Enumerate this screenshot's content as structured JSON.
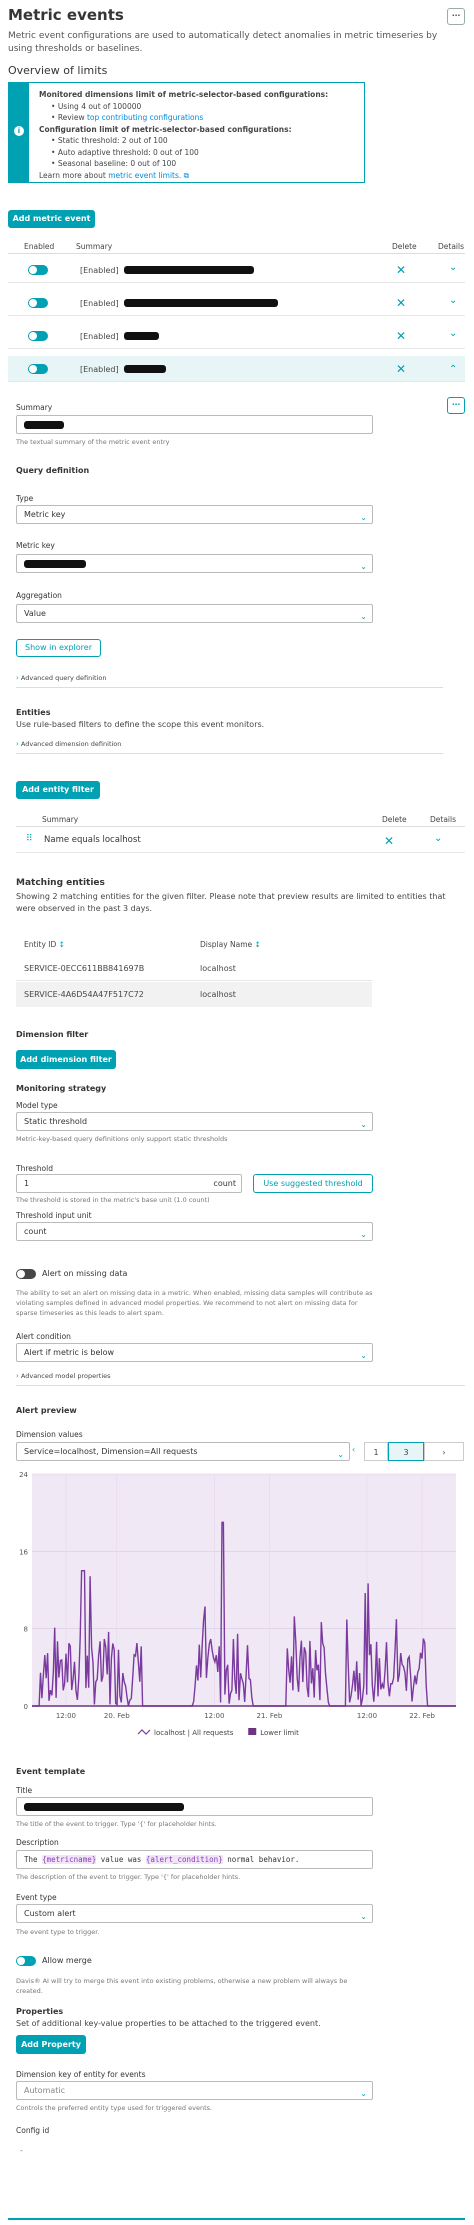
{
  "page": {
    "title": "Metric events",
    "menu_label": "⋯",
    "description": "Metric event configurations are used to automatically detect anomalies in metric timeseries by using thresholds or baselines."
  },
  "overview": {
    "heading": "Overview of limits",
    "info_icon": "i",
    "line1": "Monitored dimensions limit of metric-selector-based configurations:",
    "line2": "Using 4 out of 100000",
    "line3_prefix": "Review ",
    "line3_link": "top contributing configurations",
    "line4": "Configuration limit of metric-selector-based configurations:",
    "line5": "Static threshold: 2 out of 100",
    "line6": "Auto adaptive threshold: 0 out of 100",
    "line7": "Seasonal baseline: 0 out of 100",
    "line8_prefix": "Learn more about ",
    "line8_link": "metric event limits.",
    "external_icon": "⧉"
  },
  "add_metric_event_label": "Add metric event",
  "events_table": {
    "headers": [
      "Enabled",
      "Summary",
      "Delete",
      "Details"
    ],
    "rows": [
      {
        "summary_prefix": "[Enabled]"
      },
      {
        "summary_prefix": "[Enabled]"
      },
      {
        "summary_prefix": "[Enabled]"
      },
      {
        "summary_prefix": "[Enabled]"
      }
    ],
    "delete_icon": "✕",
    "expand_icon": "⌄",
    "collapse_icon": "⌃"
  },
  "detail": {
    "more_icon": "⋯",
    "summary_label": "Summary",
    "summary_hint": "The textual summary of the metric event entry",
    "query_heading": "Query definition",
    "type_label": "Type",
    "type_value": "Metric key",
    "metric_key_label": "Metric key",
    "aggregation_label": "Aggregation",
    "aggregation_value": "Value",
    "show_explorer_label": "Show in explorer",
    "advanced_query_label": "Advanced query definition",
    "entities_heading": "Entities",
    "entities_desc": "Use rule-based filters to define the scope this event monitors.",
    "advanced_dimension_label": "Advanced dimension definition",
    "add_entity_filter_label": "Add entity filter",
    "filter_headers": [
      "Summary",
      "Delete",
      "Details"
    ],
    "filter_row": "Name equals localhost",
    "matching_heading": "Matching entities",
    "matching_desc": "Showing 2 matching entities for the given filter. Please note that preview results are limited to entities that were observed in the past 3 days.",
    "entity_headers": [
      "Entity ID",
      "Display Name"
    ],
    "entities": [
      {
        "id": "SERVICE-0ECC611BB841697B",
        "name": "localhost"
      },
      {
        "id": "SERVICE-4A6D54A47F517C72",
        "name": "localhost"
      }
    ],
    "sort_icon": "↕",
    "dimension_filter_heading": "Dimension filter",
    "add_dimension_filter_label": "Add dimension filter",
    "monitoring_heading": "Monitoring strategy",
    "model_type_label": "Model type",
    "model_type_value": "Static threshold",
    "model_type_hint": "Metric-key-based query definitions only support static thresholds",
    "threshold_label": "Threshold",
    "threshold_value": "1",
    "threshold_unit": "count",
    "suggested_threshold_label": "Use suggested threshold",
    "threshold_hint": "The threshold is stored in the metric's base unit (1.0 count)",
    "threshold_input_unit_label": "Threshold input unit",
    "threshold_input_unit_value": "count",
    "alert_missing_label": "Alert on missing data",
    "alert_missing_desc": "The ability to set an alert on missing data in a metric. When enabled, missing data samples will contribute as violating samples defined in advanced model properties. We recommend to not alert on missing data for sparse timeseries as this leads to alert spam.",
    "alert_condition_label": "Alert condition",
    "alert_condition_value": "Alert if metric is below",
    "advanced_model_label": "Advanced model properties",
    "alert_preview_heading": "Alert preview",
    "dimension_values_label": "Dimension values",
    "dimension_values_value": "Service=localhost, Dimension=All requests",
    "pager_prev": "‹",
    "pager_page": "1",
    "pager_current": "3",
    "pager_next": "›"
  },
  "chart_data": {
    "type": "line",
    "y_ticks": [
      "24",
      "16",
      "8",
      "0"
    ],
    "ylim": [
      0,
      24
    ],
    "x_ticks": [
      "12:00",
      "20. Feb",
      "12:00",
      "21. Feb",
      "12:00",
      "22. Feb"
    ],
    "series": [
      {
        "name": "localhost | All requests",
        "color": "#7b3a9f"
      },
      {
        "name": "Lower limit",
        "color": "#6c3483"
      }
    ]
  },
  "template": {
    "heading": "Event template",
    "title_label": "Title",
    "title_hint": "The title of the event to trigger. Type '{' for placeholder hints.",
    "description_label": "Description",
    "description_parts": [
      "The ",
      "{metricname}",
      " value was ",
      "{alert_condition}",
      " normal behavior."
    ],
    "description_hint": "The description of the event to trigger. Type '{' for placeholder hints.",
    "event_type_label": "Event type",
    "event_type_value": "Custom alert",
    "event_type_hint": "The event type to trigger.",
    "allow_merge_label": "Allow merge",
    "allow_merge_desc": "Davis® AI will try to merge this event into existing problems, otherwise a new problem will always be created.",
    "properties_heading": "Properties",
    "properties_desc": "Set of additional key-value properties to be attached to the triggered event.",
    "add_property_label": "Add Property",
    "dimension_key_label": "Dimension key of entity for events",
    "dimension_key_value": "Automatic",
    "dimension_key_hint": "Controls the preferred entity type used for triggered events.",
    "config_id_label": "Config id",
    "config_id_value": "-"
  }
}
